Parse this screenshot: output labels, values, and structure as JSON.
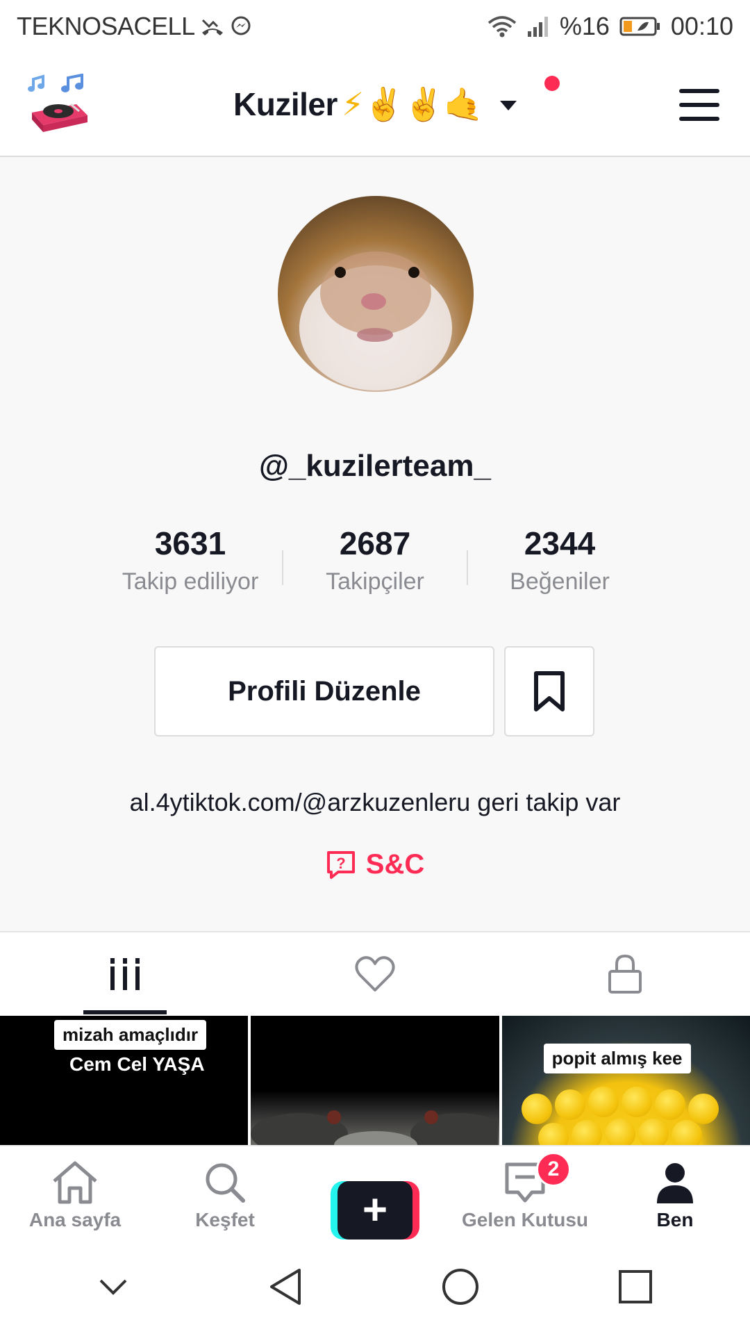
{
  "status_bar": {
    "carrier": "TEKNOSACELL",
    "battery": "%16",
    "time": "00:10"
  },
  "header": {
    "title": "Kuziler",
    "title_emojis": "⚡✌️✌️🤙"
  },
  "profile": {
    "username": "@_kuzilerteam_",
    "stats": [
      {
        "value": "3631",
        "label": "Takip ediliyor"
      },
      {
        "value": "2687",
        "label": "Takipçiler"
      },
      {
        "value": "2344",
        "label": "Beğeniler"
      }
    ],
    "edit_button": "Profili Düzenle",
    "bio": "al.4ytiktok.com/@arzkuzenleru geri takip var",
    "qa_label": "S&C"
  },
  "videos": [
    {
      "label": "mizah amaçlıdır",
      "caption": "Cem Cel YAŞA"
    },
    {
      "label": "",
      "caption": ""
    },
    {
      "label": "popit almış kee",
      "caption": ""
    }
  ],
  "bottom_nav": {
    "home": "Ana sayfa",
    "discover": "Keşfet",
    "inbox": "Gelen Kutusu",
    "inbox_badge": "2",
    "me": "Ben"
  },
  "colors": {
    "accent": "#fe2c55",
    "cyan": "#25f4ee",
    "text": "#161823",
    "muted": "#8a8b91"
  }
}
